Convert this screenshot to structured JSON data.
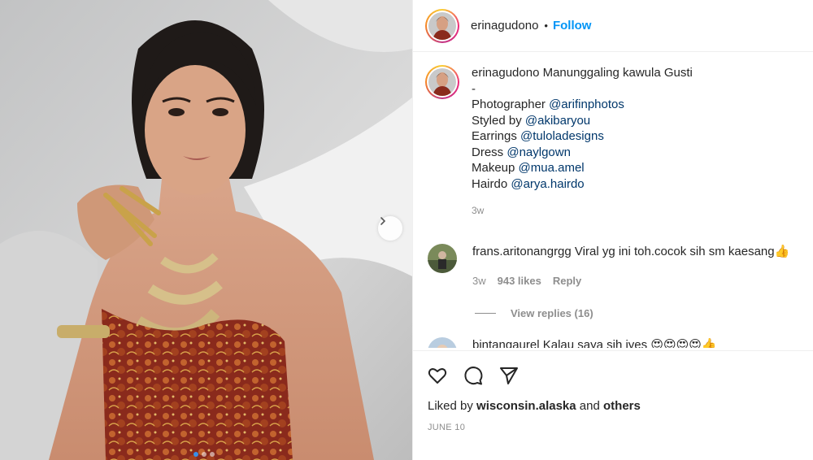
{
  "post": {
    "username": "erinagudono",
    "separator": "•",
    "follow_label": "Follow"
  },
  "caption": {
    "username": "erinagudono",
    "text": "Manunggaling kawula Gusti",
    "dash": "-",
    "lines": [
      {
        "label": "Photographer",
        "mention": "@arifinphotos"
      },
      {
        "label": "Styled by",
        "mention": "@akibaryou"
      },
      {
        "label": "Earrings",
        "mention": "@tuloladesigns"
      },
      {
        "label": "Dress",
        "mention": "@naylgown"
      },
      {
        "label": "Makeup",
        "mention": "@mua.amel"
      },
      {
        "label": "Hairdo",
        "mention": "@arya.hairdo"
      }
    ],
    "time": "3w"
  },
  "comments": [
    {
      "username": "frans.aritonangrgg",
      "text": "Viral yg ini toh.cocok sih sm kaesang👍",
      "time": "3w",
      "likes": "943 likes",
      "reply_label": "Reply",
      "view_replies": "View replies (16)"
    },
    {
      "username": "bintangaurel",
      "text": "Kalau saya sih iyes 😍😍😍😍👍"
    }
  ],
  "footer": {
    "liked_prefix": "Liked by",
    "liked_user": "wisconsin.alaska",
    "liked_and": "and",
    "liked_others": "others",
    "date": "JUNE 10"
  },
  "icons": {
    "like": "heart-icon",
    "comment": "comment-icon",
    "share": "share-icon",
    "next": "chevron-right-icon"
  },
  "colors": {
    "follow": "#0095f6",
    "mention": "#00376b",
    "meta": "#8e8e8e",
    "text": "#262626"
  }
}
